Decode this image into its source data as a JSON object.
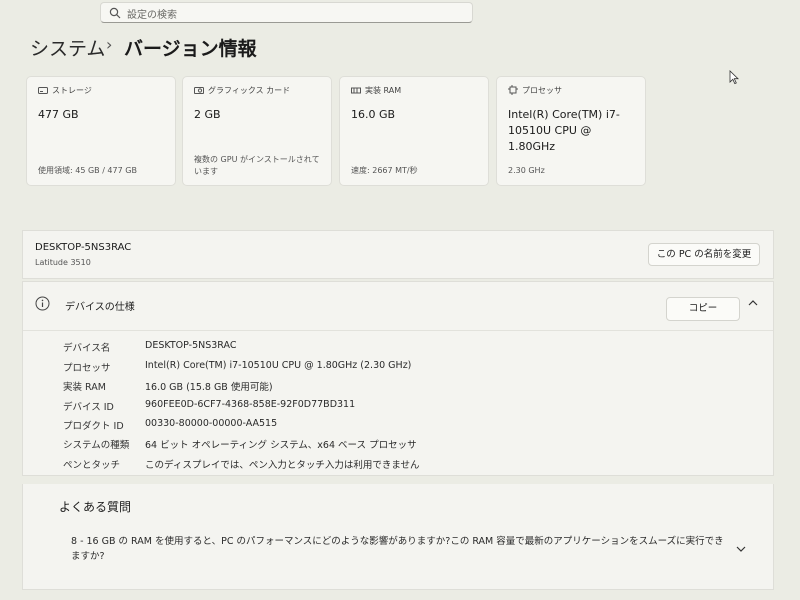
{
  "search": {
    "placeholder": "設定の検索"
  },
  "breadcrumb": {
    "parent": "システム",
    "current": "バージョン情報"
  },
  "cards": [
    {
      "label": "ストレージ",
      "value": "477 GB",
      "sub": "使用領域: 45 GB / 477 GB",
      "icon": "storage-icon"
    },
    {
      "label": "グラフィックス カード",
      "value": "2 GB",
      "sub": "複数の GPU がインストールされています",
      "icon": "graphics-card-icon"
    },
    {
      "label": "実装 RAM",
      "value": "16.0 GB",
      "sub": "速度: 2667 MT/秒",
      "icon": "ram-icon"
    },
    {
      "label": "プロセッサ",
      "value": "Intel(R) Core(TM) i7-10510U CPU @ 1.80GHz",
      "sub": "2.30 GHz",
      "icon": "processor-icon"
    }
  ],
  "device": {
    "name": "DESKTOP-5NS3RAC",
    "model": "Latitude 3510",
    "rename_label": "この PC の名前を変更"
  },
  "specs": {
    "title": "デバイスの仕様",
    "copy_label": "コピー",
    "rows": [
      {
        "key": "デバイス名",
        "value": "DESKTOP-5NS3RAC"
      },
      {
        "key": "プロセッサ",
        "value": "Intel(R) Core(TM) i7-10510U CPU @ 1.80GHz (2.30 GHz)"
      },
      {
        "key": "実装 RAM",
        "value": "16.0 GB (15.8 GB 使用可能)"
      },
      {
        "key": "デバイス ID",
        "value": "960FEE0D-6CF7-4368-858E-92F0D77BD311"
      },
      {
        "key": "プロダクト ID",
        "value": "00330-80000-00000-AA515"
      },
      {
        "key": "システムの種類",
        "value": "64 ビット オペレーティング システム、x64 ベース プロセッサ"
      },
      {
        "key": "ペンとタッチ",
        "value": "このディスプレイでは、ペン入力とタッチ入力は利用できません"
      }
    ]
  },
  "faq": {
    "title": "よくある質問",
    "question": "8 - 16 GB の RAM を使用すると、PC のパフォーマンスにどのような影響がありますか?この RAM 容量で最新のアプリケーションをスムーズに実行できますか?"
  }
}
